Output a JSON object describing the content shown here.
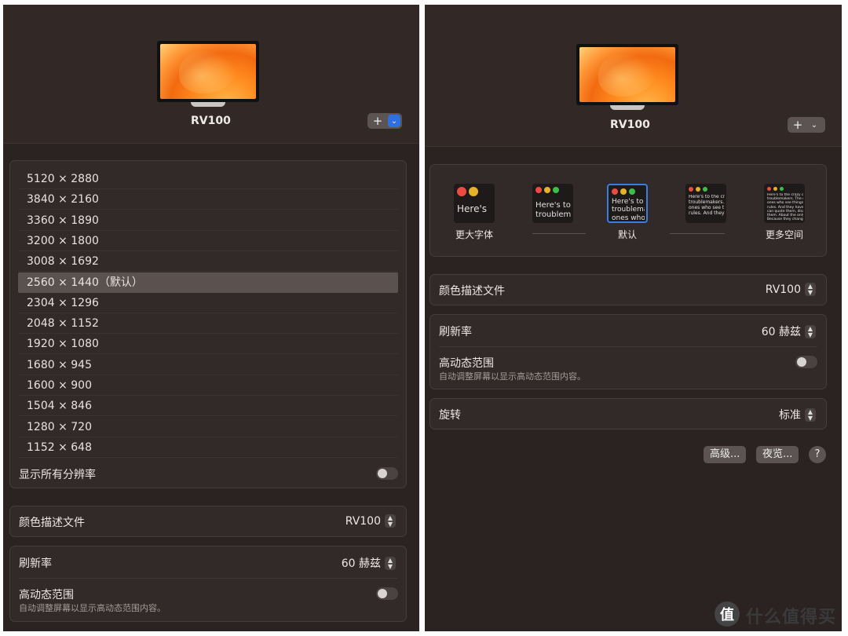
{
  "left": {
    "display_name": "RV100",
    "add_button": {
      "plus": "+",
      "chevron": "⌄",
      "accent": "#2f6fe0"
    },
    "resolutions": [
      "5120 × 2880",
      "3840 × 2160",
      "3360 × 1890",
      "3200 × 1800",
      "3008 × 1692",
      "2560 × 1440（默认）",
      "2304 × 1296",
      "2048 × 1152",
      "1920 × 1080",
      "1680 × 945",
      "1600 × 900",
      "1504 × 846",
      "1280 × 720",
      "1152 × 648"
    ],
    "selected_resolution": "2560 × 1440（默认）",
    "show_all_label": "显示所有分辨率",
    "color_profile": {
      "label": "颜色描述文件",
      "value": "RV100"
    },
    "refresh_rate": {
      "label": "刷新率",
      "value": "60 赫兹"
    },
    "hdr": {
      "label": "高动态范围",
      "sub": "自动调整屏幕以显示高动态范围内容。"
    }
  },
  "right": {
    "display_name": "RV100",
    "add_button": {
      "plus": "+",
      "chevron": "⌄"
    },
    "scale_options": [
      {
        "label": "更大字体",
        "text": "Here's"
      },
      {
        "label": "",
        "text": "Here's to\ntroublem"
      },
      {
        "label": "默认",
        "text": "Here's to t\ntroublema\nones who"
      },
      {
        "label": "",
        "text": "Here's to the cr\ntroublemakers.\nones who see t\nrules. And they"
      },
      {
        "label": "更多空间",
        "text": "Here's to the crazy one\ntroublemakers. The rou\nones who see things diff\nrules. And they have no\ncan quote them, disagre\nthem. About the only th\nBecause they change th"
      }
    ],
    "color_profile": {
      "label": "颜色描述文件",
      "value": "RV100"
    },
    "refresh_rate": {
      "label": "刷新率",
      "value": "60 赫兹"
    },
    "hdr": {
      "label": "高动态范围",
      "sub": "自动调整屏幕以显示高动态范围内容。"
    },
    "rotation": {
      "label": "旋转",
      "value": "标准"
    },
    "buttons": {
      "advanced": "高级...",
      "night_shift": "夜览...",
      "help": "?"
    }
  },
  "watermark": {
    "logo": "值",
    "text": "什么值得买"
  }
}
